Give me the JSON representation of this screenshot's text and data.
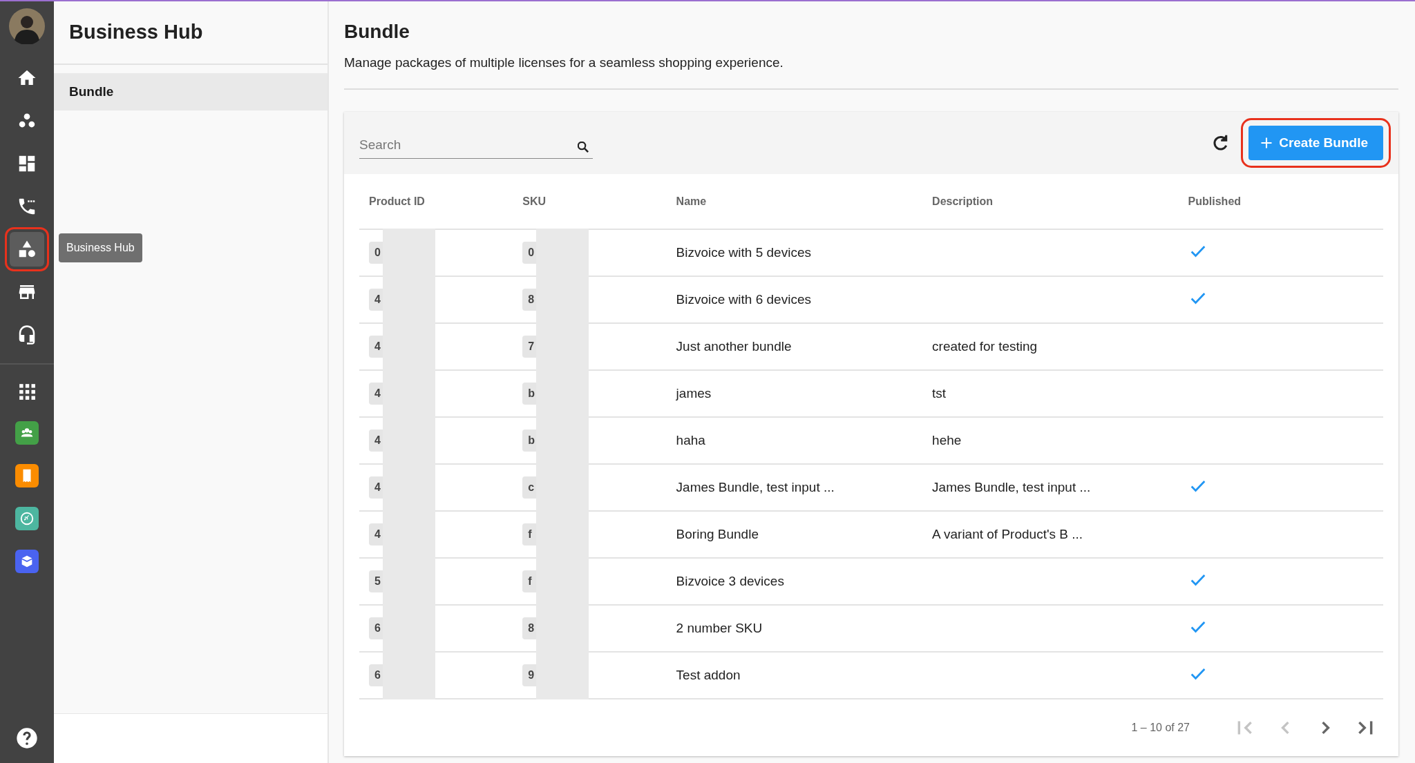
{
  "nav": {
    "items": [
      {
        "kind": "home",
        "selected": false
      },
      {
        "kind": "groups",
        "selected": false
      },
      {
        "kind": "dashboard",
        "selected": false
      },
      {
        "kind": "phone",
        "selected": false
      },
      {
        "kind": "shapes",
        "selected": true
      },
      {
        "kind": "store",
        "selected": false
      },
      {
        "kind": "headset",
        "selected": false
      }
    ],
    "apps": [
      {
        "kind": "grid"
      },
      {
        "kind": "people-app",
        "color": "#43a047"
      },
      {
        "kind": "receipt-app",
        "color": "#fb8c00"
      },
      {
        "kind": "plane-app",
        "color": "#4db6a0"
      },
      {
        "kind": "box-app",
        "color": "#4a63f0"
      }
    ],
    "tooltip": "Business Hub"
  },
  "side_panel": {
    "title": "Business Hub",
    "items": [
      {
        "label": "Bundle",
        "selected": true
      }
    ]
  },
  "page": {
    "title": "Bundle",
    "subtitle": "Manage packages of multiple licenses for a seamless shopping experience."
  },
  "toolbar": {
    "search": {
      "placeholder": "Search"
    },
    "create_button": "Create Bundle"
  },
  "table": {
    "columns": [
      "Product ID",
      "SKU",
      "Name",
      "Description",
      "Published"
    ],
    "rows": [
      {
        "product_id": "0",
        "sku": "0",
        "name": "Bizvoice with 5 devices",
        "description": "",
        "published": true
      },
      {
        "product_id": "4",
        "sku": "8",
        "name": "Bizvoice with 6 devices",
        "description": "",
        "published": true
      },
      {
        "product_id": "4",
        "sku": "7",
        "name": "Just another bundle",
        "description": "created for testing",
        "published": false
      },
      {
        "product_id": "4",
        "sku": "b",
        "name": "james",
        "description": "tst",
        "published": false
      },
      {
        "product_id": "4",
        "sku": "b",
        "name": "haha",
        "description": "hehe",
        "published": false
      },
      {
        "product_id": "4",
        "sku": "c",
        "name": "James Bundle, test input ...",
        "description": "James Bundle, test input ...",
        "published": true
      },
      {
        "product_id": "4",
        "sku": "f",
        "name": "Boring Bundle",
        "description": "A variant of Product's B ...",
        "published": false
      },
      {
        "product_id": "5",
        "sku": "f",
        "name": "Bizvoice 3 devices",
        "description": "",
        "published": true
      },
      {
        "product_id": "6",
        "sku": "8",
        "name": "2 number SKU",
        "description": "",
        "published": true
      },
      {
        "product_id": "6",
        "sku": "9",
        "name": "Test addon",
        "description": "",
        "published": true
      }
    ]
  },
  "pagination": {
    "range": "1 – 10 of 27",
    "buttons": [
      {
        "kind": "first",
        "disabled": true
      },
      {
        "kind": "prev",
        "disabled": true
      },
      {
        "kind": "next",
        "disabled": false
      },
      {
        "kind": "last",
        "disabled": false
      }
    ]
  }
}
